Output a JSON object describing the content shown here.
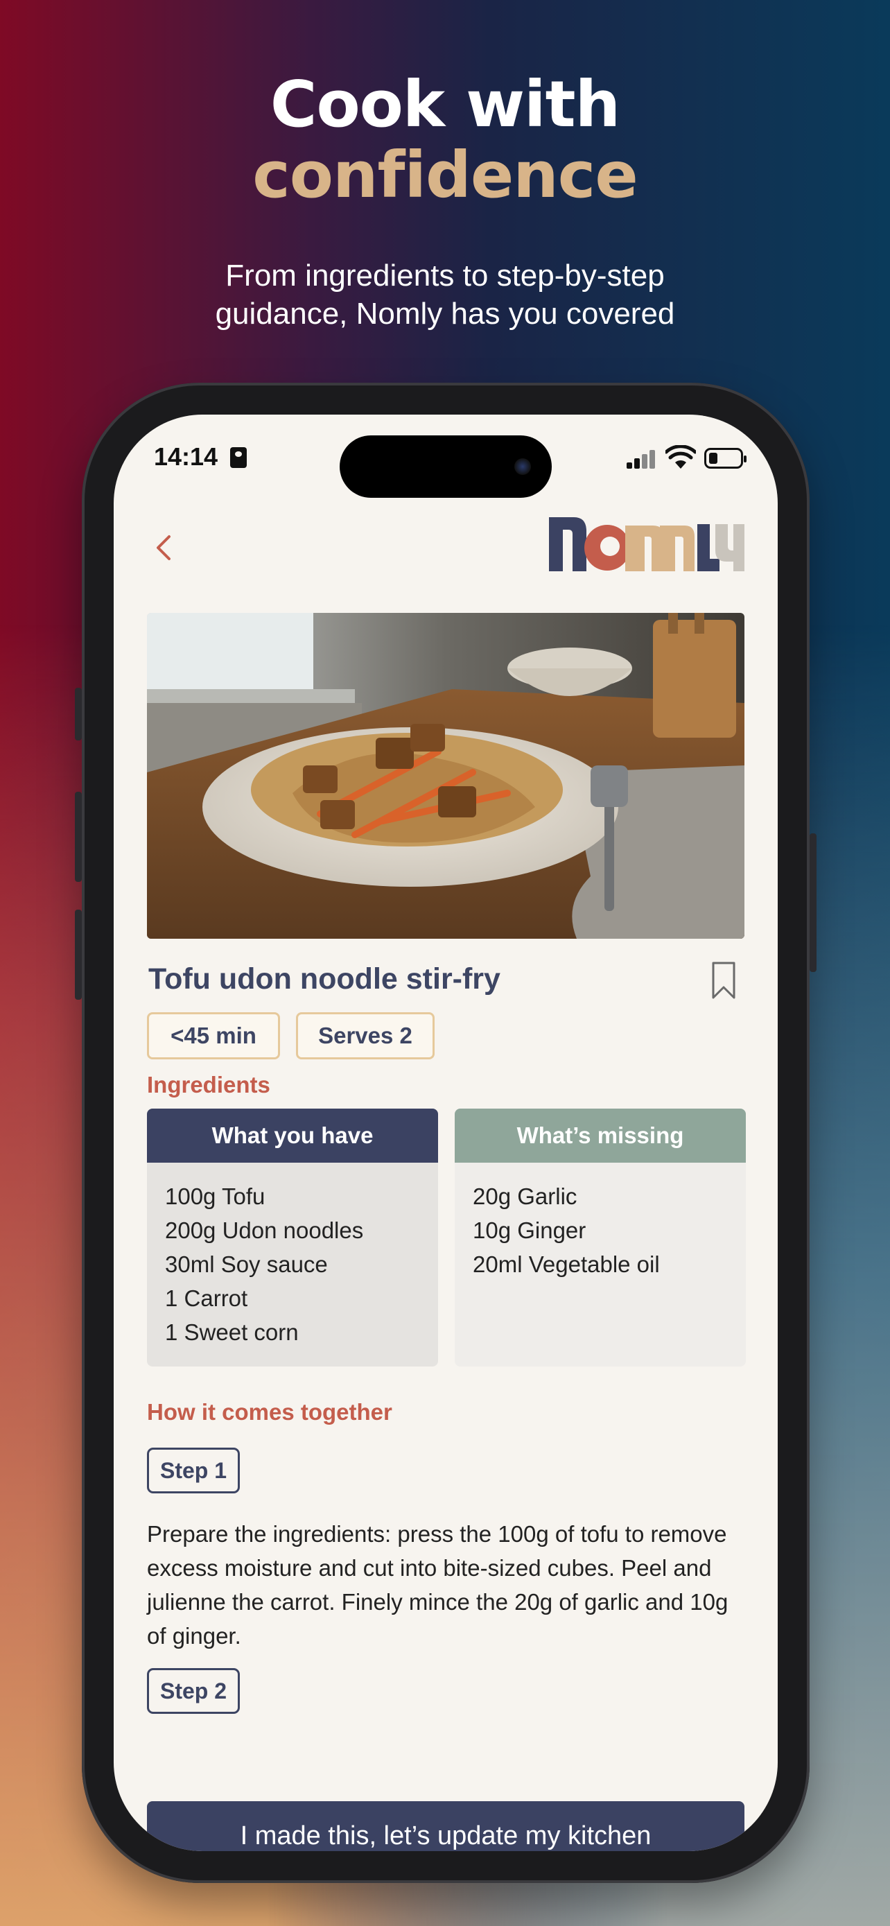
{
  "hero": {
    "title_line1": "Cook with",
    "title_line2": "confidence",
    "subtitle_line1": "From ingredients to step-by-step",
    "subtitle_line2": "guidance, Nomly has you covered"
  },
  "status_bar": {
    "time": "14:14"
  },
  "header": {
    "back_icon": "chevron-left-icon",
    "logo": "NOMLY"
  },
  "recipe": {
    "title": "Tofu udon noodle stir-fry",
    "time_chip": "<45 min",
    "serves_chip": "Serves 2"
  },
  "ingredients": {
    "label": "Ingredients",
    "have": {
      "header": "What you have",
      "items": [
        "100g Tofu",
        "200g Udon noodles",
        "30ml Soy sauce",
        "1 Carrot",
        "1 Sweet corn"
      ]
    },
    "missing": {
      "header": "What’s missing",
      "items": [
        "20g Garlic",
        "10g Ginger",
        "20ml Vegetable oil"
      ]
    }
  },
  "method": {
    "label": "How it comes together",
    "steps": [
      {
        "label": "Step 1",
        "text": "Prepare the ingredients: press the 100g of tofu to remove excess moisture and cut into bite-sized cubes. Peel and julienne the carrot. Finely mince the 20g of garlic and 10g of ginger."
      },
      {
        "label": "Step 2"
      }
    ]
  },
  "cta": {
    "label": "I made this, let’s update my kitchen"
  },
  "colors": {
    "navy": "#3b4262",
    "sage": "#8fa69a",
    "terracotta": "#c45d4c",
    "sand": "#d8b489",
    "screen_bg": "#f7f4ef"
  }
}
